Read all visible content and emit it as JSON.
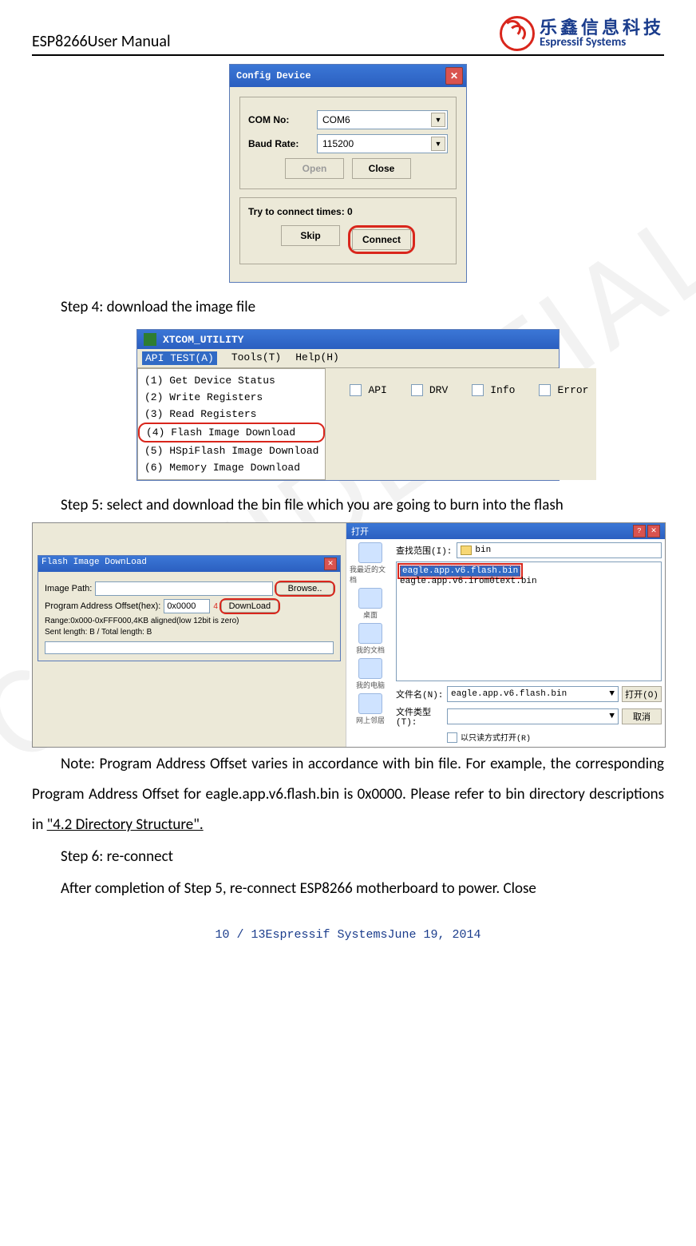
{
  "header": {
    "title": "ESP8266User Manual"
  },
  "logo": {
    "cn": "乐鑫信息科技",
    "en": "Espressif Systems"
  },
  "watermark": "CONFIDENTIAL",
  "dlg1": {
    "title": "Config Device",
    "com_label": "COM No:",
    "com_value": "COM6",
    "baud_label": "Baud Rate:",
    "baud_value": "115200",
    "open_btn": "Open",
    "close_btn": "Close",
    "try_line": "Try to connect times: 0",
    "skip_btn": "Skip",
    "connect_btn": "Connect"
  },
  "step4_text": "Step 4: download the image file",
  "xtcom": {
    "title": "XTCOM_UTILITY",
    "menu_api": "API TEST(A)",
    "menu_tools": "Tools(T)",
    "menu_help": "Help(H)",
    "items": [
      "(1) Get Device Status",
      "(2) Write Registers",
      "(3) Read Registers",
      "(4) Flash Image Download",
      "(5) HSpiFlash Image Download",
      "(6) Memory Image Download"
    ],
    "chk_api": "API",
    "chk_drv": "DRV",
    "chk_info": "Info",
    "chk_error": "Error"
  },
  "step5_text": "Step 5: select and download the bin file which you are going to burn into the flash",
  "s5": {
    "dlg_title": "Flash Image DownLoad",
    "image_path_lbl": "Image Path:",
    "browse_btn": "Browse..",
    "offset_lbl": "Program Address Offset(hex):",
    "offset_val": "0x0000",
    "offset_num": "4",
    "download_btn": "DownLoad",
    "range": "Range:0x000-0xFFF000,4KB aligned(low 12bit is zero)",
    "sent": "Sent length:      B / Total length:        B",
    "open_title": "打开",
    "lookin_lbl": "查找范围(I):",
    "folder": "bin",
    "file_sel": "eagle.app.v6.flash.bin",
    "file2": "eagle.app.v6.irom0text.bin",
    "places": [
      "我最近的文档",
      "桌面",
      "我的文档",
      "我的电脑",
      "网上邻居"
    ],
    "fname_lbl": "文件名(N):",
    "fname_val": "eagle.app.v6.flash.bin",
    "ftype_lbl": "文件类型(T):",
    "open_btn": "打开(O)",
    "cancel_btn": "取消",
    "readonly": "以只读方式打开(R)"
  },
  "note_text": "Note: Program Address Offset varies in accordance with bin file. For example, the corresponding Program Address Offset for eagle.app.v6.flash.bin is 0x0000. Please refer to bin directory descriptions in ",
  "note_link": "\"4.2 Directory Structure\".",
  "step6_text": "Step 6: re-connect",
  "step6b_text": "After completion of Step 5, re-connect ESP8266 motherboard to power. Close",
  "footer": "10 / 13Espressif SystemsJune 19, 2014"
}
